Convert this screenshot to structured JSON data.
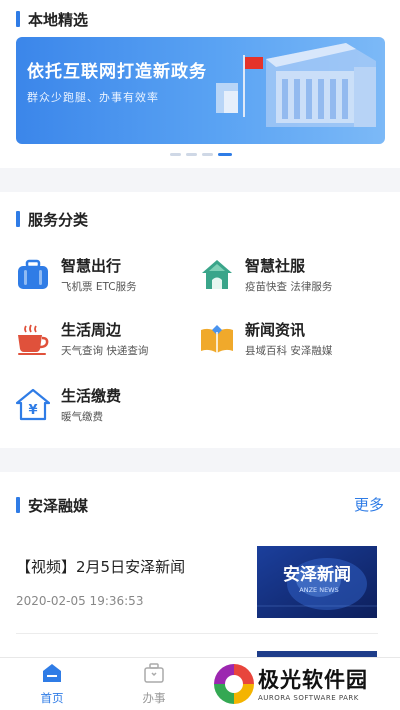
{
  "local": {
    "title": "本地精选",
    "banner": {
      "headline": "依托互联网打造新政务",
      "subline": "群众少跑腿、办事有效率"
    },
    "carousel": {
      "count": 4,
      "active": 4
    }
  },
  "services": {
    "title": "服务分类",
    "items": [
      {
        "name": "智慧出行",
        "desc": "飞机票  ETC服务",
        "icon": "suitcase-icon",
        "color": "#2f7ce6"
      },
      {
        "name": "智慧社服",
        "desc": "疫苗快查  法律服务",
        "icon": "house-icon",
        "color": "#3aa58a"
      },
      {
        "name": "生活周边",
        "desc": "天气查询  快递查询",
        "icon": "coffee-cup-icon",
        "color": "#e0513b"
      },
      {
        "name": "新闻资讯",
        "desc": "县域百科  安泽融媒",
        "icon": "open-book-icon",
        "color": "#f0a92b"
      },
      {
        "name": "生活缴费",
        "desc": "暖气缴费",
        "icon": "yen-house-icon",
        "color": "#2f7ce6"
      }
    ]
  },
  "news": {
    "title": "安泽融媒",
    "more_label": "更多",
    "items": [
      {
        "title": "【视频】2月5日安泽新闻",
        "time": "2020-02-05 19:36:53",
        "thumb_title": "安泽新闻",
        "thumb_sub": "ANZE NEWS"
      }
    ]
  },
  "tabbar": {
    "tabs": [
      {
        "label": "首页",
        "active": true
      },
      {
        "label": "办事",
        "active": false
      }
    ]
  },
  "watermark": {
    "text": "极光软件园",
    "sub": "AURORA SOFTWARE PARK"
  },
  "colors": {
    "accent": "#2f7ce6",
    "banner": "#4a93ee"
  }
}
